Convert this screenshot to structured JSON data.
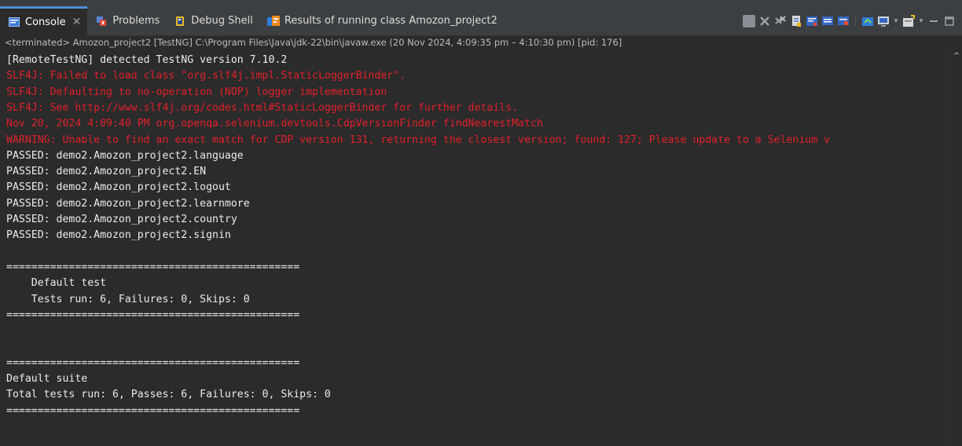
{
  "tabs": [
    {
      "label": "Console",
      "active": true,
      "closable": true,
      "icon": "console-icon"
    },
    {
      "label": "Problems",
      "active": false,
      "icon": "problems-icon"
    },
    {
      "label": "Debug Shell",
      "active": false,
      "icon": "debug-shell-icon"
    },
    {
      "label": "Results of running class Amozon_project2",
      "active": false,
      "icon": "testng-results-icon"
    }
  ],
  "close_glyph": "✕",
  "toolbar": {
    "icons": [
      "terminate-icon",
      "remove-launch-icon",
      "remove-all-terminated-icon",
      "scroll-lock-icon",
      "word-wrap-icon",
      "show-stdout-icon",
      "show-stderr-icon",
      "pin-console-icon",
      "display-selected-console-icon",
      "open-console-icon",
      "minimize-icon",
      "maximize-icon"
    ]
  },
  "status_line": "<terminated> Amozon_project2 [TestNG] C:\\Program Files\\Java\\jdk-22\\bin\\javaw.exe  (20 Nov 2024, 4:09:35 pm – 4:10:30 pm) [pid: 176]",
  "console_lines": [
    {
      "text": "[RemoteTestNG] detected TestNG version 7.10.2",
      "type": "out"
    },
    {
      "text": "SLF4J: Failed to load class \"org.slf4j.impl.StaticLoggerBinder\".",
      "type": "err"
    },
    {
      "text": "SLF4J: Defaulting to no-operation (NOP) logger implementation",
      "type": "err"
    },
    {
      "text": "SLF4J: See http://www.slf4j.org/codes.html#StaticLoggerBinder for further details.",
      "type": "err"
    },
    {
      "text": "Nov 20, 2024 4:09:40 PM org.openqa.selenium.devtools.CdpVersionFinder findNearestMatch",
      "type": "err"
    },
    {
      "text": "WARNING: Unable to find an exact match for CDP version 131, returning the closest version; found: 127; Please update to a Selenium v",
      "type": "err"
    },
    {
      "text": "PASSED: demo2.Amozon_project2.language",
      "type": "out"
    },
    {
      "text": "PASSED: demo2.Amozon_project2.EN",
      "type": "out"
    },
    {
      "text": "PASSED: demo2.Amozon_project2.logout",
      "type": "out"
    },
    {
      "text": "PASSED: demo2.Amozon_project2.learnmore",
      "type": "out"
    },
    {
      "text": "PASSED: demo2.Amozon_project2.country",
      "type": "out"
    },
    {
      "text": "PASSED: demo2.Amozon_project2.signin",
      "type": "out"
    },
    {
      "text": "",
      "type": "out"
    },
    {
      "text": "===============================================",
      "type": "out"
    },
    {
      "text": "    Default test",
      "type": "out"
    },
    {
      "text": "    Tests run: 6, Failures: 0, Skips: 0",
      "type": "out"
    },
    {
      "text": "===============================================",
      "type": "out"
    },
    {
      "text": "",
      "type": "out"
    },
    {
      "text": "",
      "type": "out"
    },
    {
      "text": "===============================================",
      "type": "out"
    },
    {
      "text": "Default suite",
      "type": "out"
    },
    {
      "text": "Total tests run: 6, Passes: 6, Failures: 0, Skips: 0",
      "type": "out"
    },
    {
      "text": "===============================================",
      "type": "out"
    }
  ],
  "scroll_up_glyph": "^",
  "colors": {
    "error": "#e0202a",
    "text": "#ebebeb",
    "background": "#2b2b2b",
    "accent": "#4a90d9"
  }
}
